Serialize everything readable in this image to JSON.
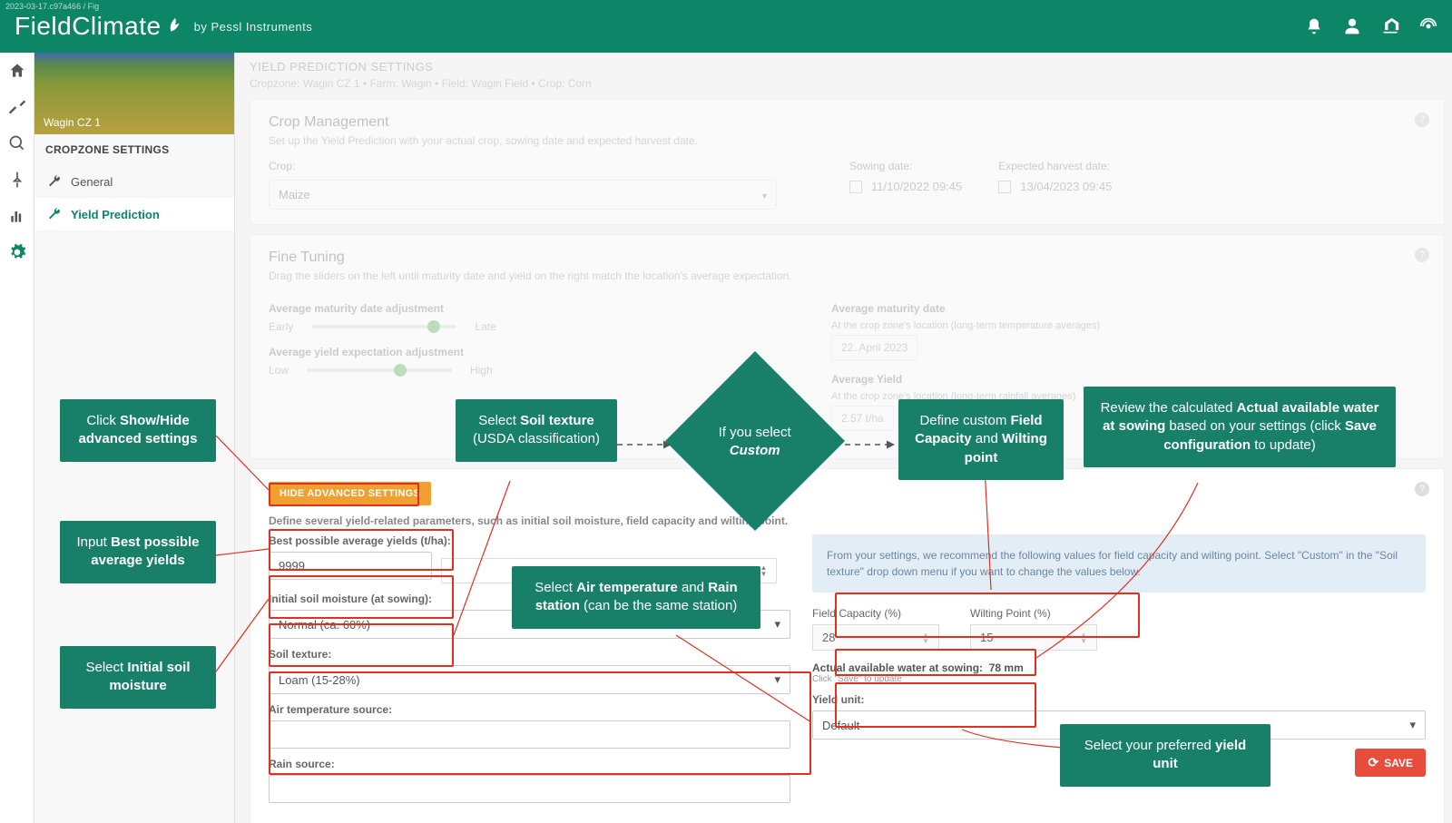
{
  "build_tag": "2023-03-17.c97a466 / Fig",
  "brand": "FieldClimate",
  "brand_sub": "by Pessl Instruments",
  "sidebar": {
    "thumb_label": "Wagin CZ 1",
    "section": "CROPZONE SETTINGS",
    "items": [
      {
        "label": "General"
      },
      {
        "label": "Yield Prediction"
      }
    ]
  },
  "page": {
    "title": "YIELD PREDICTION SETTINGS",
    "breadcrumb": "Cropzone: Wagin CZ 1 • Farm: Wagin • Field: Wagin Field • Crop: Corn"
  },
  "crop_mgmt": {
    "title": "Crop Management",
    "sub": "Set up the Yield Prediction with your actual crop, sowing date and expected harvest date.",
    "crop_label": "Crop:",
    "crop_value": "Maize",
    "sowing_label": "Sowing date:",
    "sowing_value": "11/10/2022 09:45",
    "harvest_label": "Expected harvest date:",
    "harvest_value": "13/04/2023 09:45"
  },
  "fine": {
    "title": "Fine Tuning",
    "sub": "Drag the sliders on the left until maturity date and yield on the right match the location's average expectation.",
    "maturity_label": "Average maturity date adjustment",
    "early": "Early",
    "late": "Late",
    "yield_label": "Average yield expectation adjustment",
    "low": "Low",
    "high": "High",
    "matdate_title": "Average maturity date",
    "matdate_sub": "At the crop zone's location (long-term temperature averages)",
    "matdate_val": "22. April 2023",
    "avgy_title": "Average Yield",
    "avgy_sub": "At the crop zone's location (long-term rainfall averages)",
    "avgy_val": "2.57 t/ha"
  },
  "adv": {
    "btn": "HIDE ADVANCED SETTINGS",
    "desc": "Define several yield-related parameters, such as initial soil moisture, field capacity and wilting point.",
    "best_label": "Best possible average yields (t/ha):",
    "best_value": "9999",
    "ism_label": "Initial soil moisture (at sowing):",
    "ism_value": "Normal (ca. 60%)",
    "soil_label": "Soil texture:",
    "soil_value": "Loam (15-28%)",
    "air_label": "Air temperature source:",
    "rain_label": "Rain source:",
    "info": "From your settings, we recommend the following values for field capacity and wilting point. Select \"Custom\" in the \"Soil texture\" drop down menu if you want to change the values below.",
    "fc_label": "Field Capacity (%)",
    "fc_value": "28",
    "wp_label": "Wilting Point (%)",
    "wp_value": "15",
    "aaw_label": "Actual available water at sowing:",
    "aaw_value": "78 mm",
    "savehint": "Click \"Save\" to update",
    "yu_label": "Yield unit:",
    "yu_value": "Default",
    "save": "SAVE"
  },
  "callouts": {
    "c1a": "Click ",
    "c1b": "Show/Hide advanced settings",
    "c2a": "Input ",
    "c2b": "Best possible average yields",
    "c3a": "Select ",
    "c3b": "Initial soil moisture",
    "c4a": "Select ",
    "c4b": "Soil texture",
    "c4c": " (USDA classification)",
    "c5a": "If you select ",
    "c5b": "Custom",
    "c6a": "Define custom ",
    "c6b": "Field Capacity",
    "c6c": " and ",
    "c6d": "Wilting point",
    "c7a": "Review the calculated ",
    "c7b": "Actual available water at sowing",
    "c7c": " based on your settings (click ",
    "c7d": "Save configuration",
    "c7e": " to update)",
    "c8a": "Select ",
    "c8b": "Air temperature",
    "c8c": " and ",
    "c8d": "Rain station",
    "c8e": " (can be the same station)",
    "c9a": "Select your preferred ",
    "c9b": "yield unit"
  }
}
